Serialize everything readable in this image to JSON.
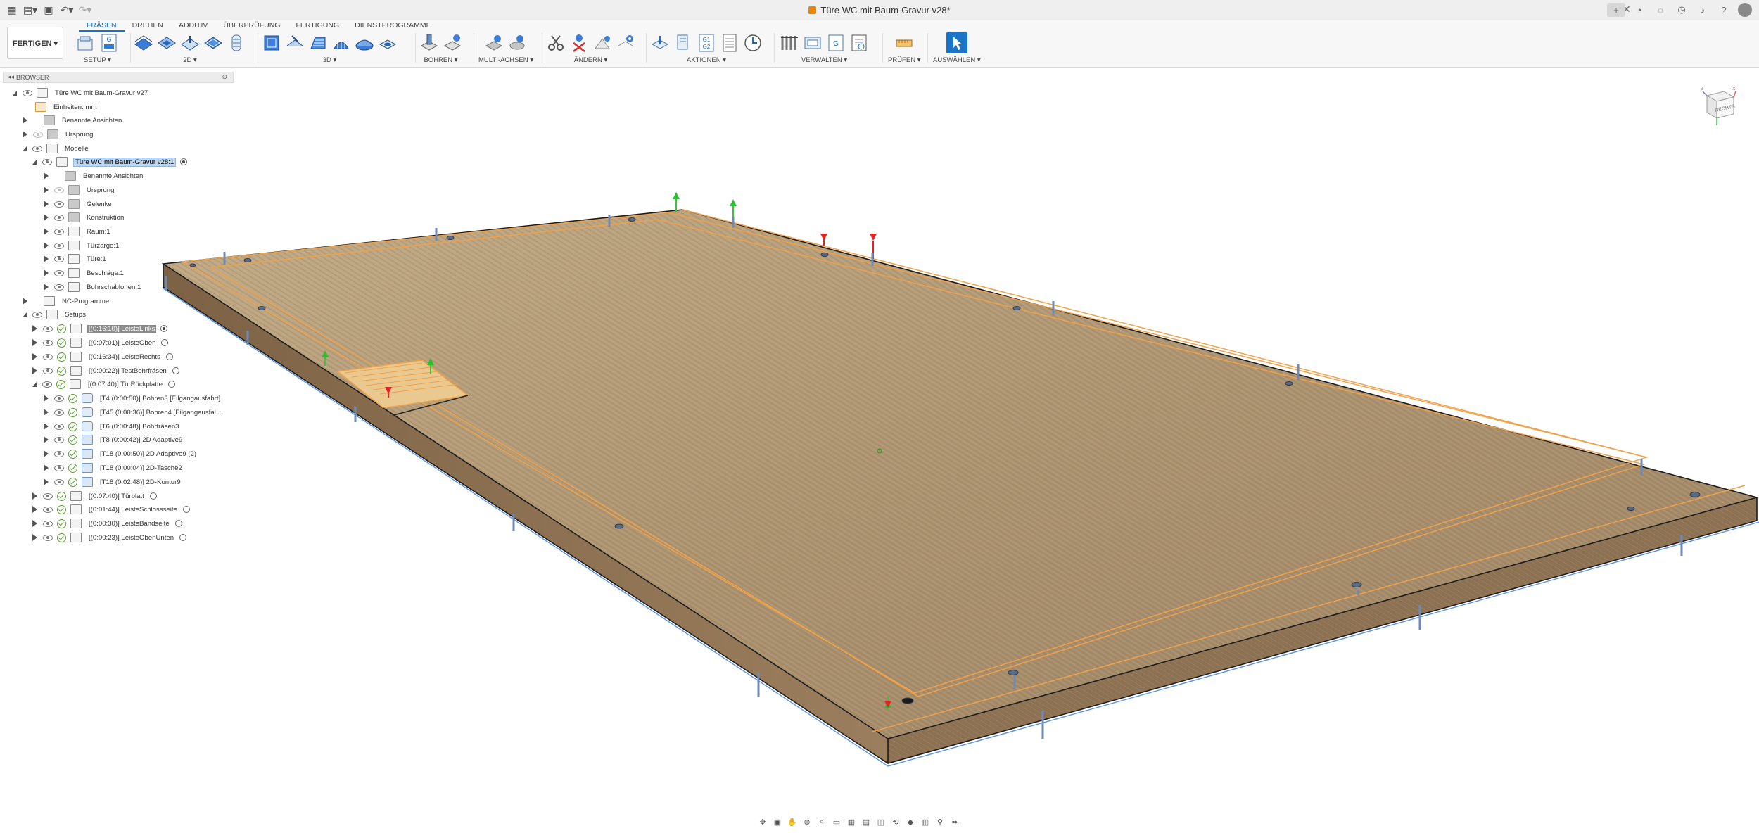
{
  "title_bar": {
    "document_title": "Türe WC mit Baum-Gravur v28*",
    "left_icons": [
      "grid-icon",
      "file-icon",
      "save-icon",
      "undo-icon",
      "redo-icon"
    ],
    "right_icons": [
      "plus-icon",
      "extensions-icon",
      "sync-icon",
      "clock-icon",
      "bell-icon",
      "help-icon",
      "avatar"
    ]
  },
  "ribbon": {
    "workspace": "FERTIGEN ▾",
    "tabs": [
      "FRÄSEN",
      "DREHEN",
      "ADDITIV",
      "ÜBERPRÜFUNG",
      "FERTIGUNG",
      "DIENSTPROGRAMME"
    ],
    "active_tab": "FRÄSEN",
    "groups": {
      "setup": "SETUP ▾",
      "two_d": "2D ▾",
      "three_d": "3D ▾",
      "drilling": "BOHREN ▾",
      "multi_axis": "MULTI-ACHSEN ▾",
      "modify": "ÄNDERN ▾",
      "actions": "AKTIONEN ▾",
      "manage": "VERWALTEN ▾",
      "inspect": "PRÜFEN ▾",
      "select": "AUSWÄHLEN ▾"
    }
  },
  "browser": {
    "header": "BROWSER",
    "items": [
      {
        "label": "Türe WC mit Baum-Gravur v27"
      },
      {
        "label": "Einheiten: mm"
      },
      {
        "label": "Benannte Ansichten"
      },
      {
        "label": "Ursprung"
      },
      {
        "label": "Modelle"
      },
      {
        "label": "Türe WC mit Baum-Gravur v28:1"
      },
      {
        "label": "Benannte Ansichten"
      },
      {
        "label": "Ursprung"
      },
      {
        "label": "Gelenke"
      },
      {
        "label": "Konstruktion"
      },
      {
        "label": "Raum:1"
      },
      {
        "label": "Türzarge:1"
      },
      {
        "label": "Türe:1"
      },
      {
        "label": "Beschläge:1"
      },
      {
        "label": "Bohrschablonen:1"
      },
      {
        "label": "NC-Programme"
      },
      {
        "label": "Setups"
      },
      {
        "label": "[(0:16:10)] LeisteLinks"
      },
      {
        "label": "[(0:07:01)] LeisteOben"
      },
      {
        "label": "[(0:16:34)] LeisteRechts"
      },
      {
        "label": "[(0:00:22)] TestBohrfräsen"
      },
      {
        "label": "[(0:07:40)] TürRückplatte"
      },
      {
        "label": "[T4 (0:00:50)] Bohren3 [Eilgangausfahrt]"
      },
      {
        "label": "[T45 (0:00:36)] Bohren4 [Eilgangausfal..."
      },
      {
        "label": "[T6 (0:00:48)] Bohrfräsen3"
      },
      {
        "label": "[T8 (0:00:42)] 2D Adaptive9"
      },
      {
        "label": "[T18 (0:00:50)] 2D Adaptive9 (2)"
      },
      {
        "label": "[T18 (0:00:04)] 2D-Tasche2"
      },
      {
        "label": "[T18 (0:02:48)] 2D-Kontur9"
      },
      {
        "label": "[(0:07:40)] Türblatt"
      },
      {
        "label": "[(0:01:44)] LeisteSchlossseite"
      },
      {
        "label": "[(0:00:30)] LeisteBandseite"
      },
      {
        "label": "[(0:00:23)] LeisteObenUnten"
      }
    ]
  },
  "viewcube": {
    "face_label": "RECHTS"
  },
  "colors": {
    "accent": "#1a6fc1",
    "toolpath": "#f0a24a",
    "wood": "#b59c78"
  }
}
